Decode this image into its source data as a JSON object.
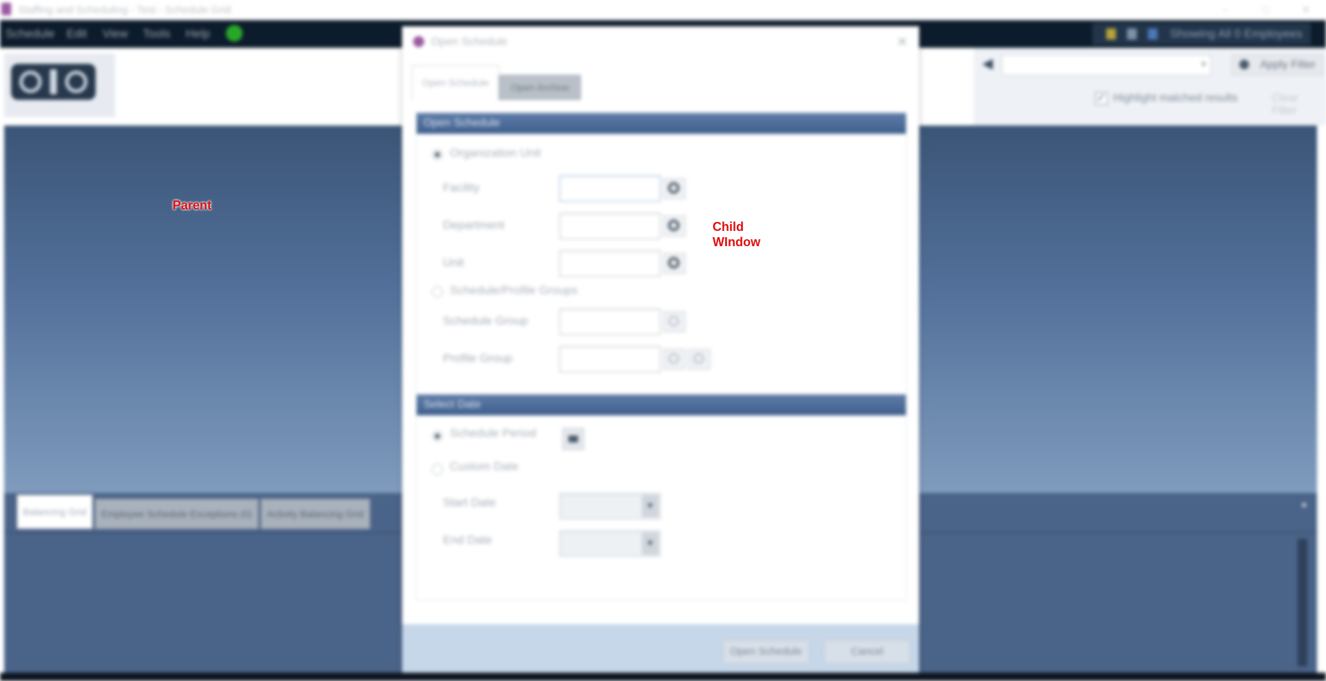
{
  "window": {
    "title": "Staffing and Scheduling - Test - Schedule Grid",
    "controls": [
      "–",
      "□",
      "✕"
    ]
  },
  "menu": {
    "items": [
      "Schedule",
      "Edit",
      "View",
      "Tools",
      "Help"
    ],
    "status_text": "Showing All 0 Employees"
  },
  "search": {
    "apply_label": "Apply Filter",
    "highlight_label": "Highlight matched results",
    "clear_label": "Clear Filter"
  },
  "bottom": {
    "tabs": [
      "Balancing Grid",
      "Employee Schedule Exceptions (0)",
      "Activity Balancing Grid"
    ]
  },
  "dialog": {
    "title": "Open Schedule",
    "close": "✕",
    "tabs": {
      "active": "Open Schedule",
      "inactive": "Open Archive"
    },
    "section1": {
      "header": "Open Schedule",
      "org_unit_label": "Organization Unit",
      "facility_label": "Facility",
      "department_label": "Department",
      "unit_label": "Unit",
      "groups_label": "Schedule/Profile Groups",
      "schedule_group_label": "Schedule Group",
      "profile_group_label": "Profile Group"
    },
    "section2": {
      "header": "Select Date",
      "period_label": "Schedule Period",
      "custom_label": "Custom Date",
      "start_label": "Start Date",
      "end_label": "End Date"
    },
    "buttons": {
      "open": "Open Schedule",
      "cancel": "Cancel"
    }
  },
  "annotations": {
    "parent": "Parent",
    "child_line1": "Child",
    "child_line2": "WIndow"
  },
  "colors": {
    "annotation": "#e01010",
    "menubar": "#0d1c2c",
    "section_header": "#4a6a96"
  }
}
